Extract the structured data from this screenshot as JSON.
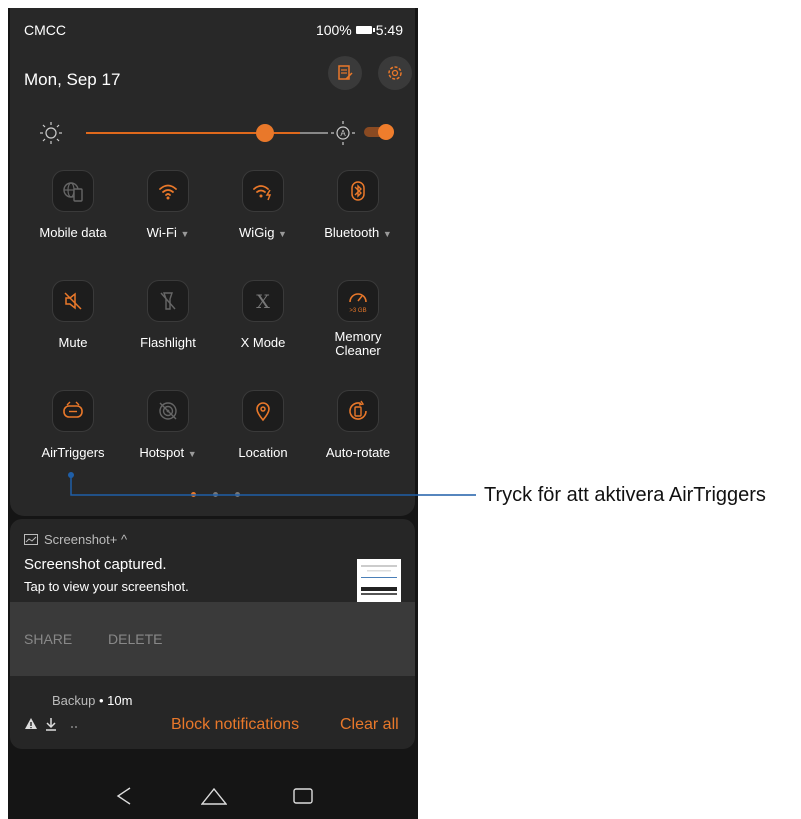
{
  "status_bar": {
    "carrier": "CMCC",
    "battery": "100%",
    "time": "5:49"
  },
  "header": {
    "date": "Mon, Sep 17"
  },
  "tiles": [
    {
      "label": "Mobile data",
      "icon": "globe-phone-icon"
    },
    {
      "label": "Wi-Fi",
      "icon": "wifi-icon",
      "dropdown": "▼"
    },
    {
      "label": "WiGig",
      "icon": "wigig-icon",
      "dropdown": "▼"
    },
    {
      "label": "Bluetooth",
      "icon": "bluetooth-icon",
      "dropdown": "▼"
    },
    {
      "label": "Mute",
      "icon": "mute-icon"
    },
    {
      "label": "Flashlight",
      "icon": "flashlight-icon"
    },
    {
      "label": "X Mode",
      "icon": "x-mode-icon"
    },
    {
      "label": "Memory\nCleaner",
      "icon": "memory-cleaner-icon",
      "badge": ">3 GB"
    },
    {
      "label": "AirTriggers",
      "icon": "airtriggers-icon"
    },
    {
      "label": "Hotspot",
      "icon": "hotspot-icon",
      "dropdown": "▼"
    },
    {
      "label": "Location",
      "icon": "location-icon"
    },
    {
      "label": "Auto-rotate",
      "icon": "auto-rotate-icon"
    }
  ],
  "notification": {
    "app": "Screenshot+ ^",
    "title": "Screenshot captured.",
    "body": "Tap to view your screenshot.",
    "actions": [
      "SHARE",
      "DELETE"
    ]
  },
  "backup": {
    "app": "Backup",
    "sep": " • ",
    "age": "10m"
  },
  "bottom_actions": {
    "block": "Block notifications",
    "clear": "Clear all"
  },
  "callout": {
    "text": "Tryck för att aktivera AirTriggers"
  },
  "colors": {
    "accent": "#e9782a",
    "panel": "#282828"
  },
  "brightness": {
    "level": 0.83,
    "auto": true
  }
}
